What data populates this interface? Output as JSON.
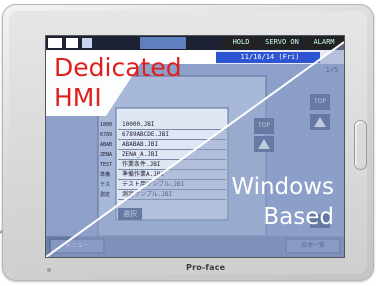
{
  "device": {
    "brand": "Pro-face"
  },
  "screen": {
    "top_bar": {
      "cells": [
        "",
        "",
        "",
        "",
        "HOLD",
        "SERVO ON",
        "ALARM"
      ]
    },
    "date_line": "11/16/14 (Fri)",
    "page_indicator": "1/5",
    "list_items": [
      "10000.JBI",
      "6789ABCDE.JBI",
      "ABABAB.JBI",
      "ZENA_A.JBI",
      "作業条件.JBI",
      "準備作業A.JBI",
      "テスト用サンプル.JBI",
      "測定サンプル.JBI"
    ],
    "side_codes": [
      "1000",
      "6789",
      "ABAB",
      "ZENA",
      "TEST",
      "準備",
      "テス",
      "測定"
    ],
    "select_label": "選択",
    "top_label": "TOP",
    "bottom_left_label": "メニュー",
    "bottom_right_label": "日本一覧"
  },
  "labels": {
    "dedicated_line1": "Dedicated",
    "dedicated_line2": "HMI",
    "windows_line1": "Windows",
    "windows_line2": "Based"
  },
  "colors": {
    "dedicated_label": "#e0201c",
    "windows_label": "#ffffff",
    "windows_tint": "#8b9ec6",
    "dedicated_bg": "#ffffff",
    "connector_line": "#9aa0b5"
  }
}
